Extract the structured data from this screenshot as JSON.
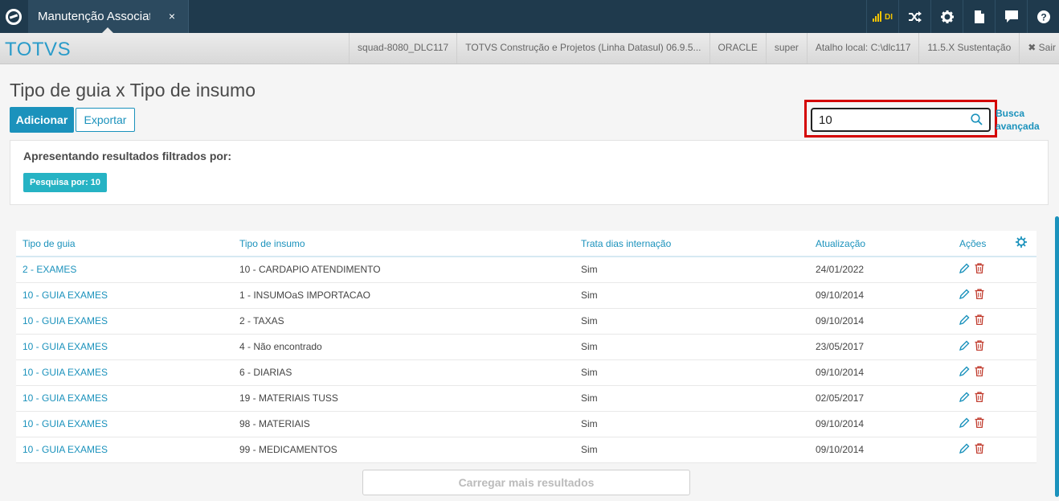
{
  "topbar": {
    "tab_label": "Manutenção Associativa",
    "tab_close": "×",
    "signal_label": "DI"
  },
  "infobar": {
    "brand": "TOTVS",
    "items": [
      "squad-8080_DLC117",
      "TOTVS Construção e Projetos (Linha Datasul) 06.9.5...",
      "ORACLE",
      "super",
      "Atalho local: C:\\dlc117",
      "11.5.X Sustentação"
    ],
    "logout": "✖ Sair"
  },
  "page": {
    "title": "Tipo de guia x Tipo de insumo",
    "add_label": "Adicionar",
    "export_label": "Exportar"
  },
  "search": {
    "value": "10",
    "advanced_line1": "Busca",
    "advanced_line2": "avançada"
  },
  "filter": {
    "title": "Apresentando resultados filtrados por:",
    "chip": "Pesquisa por: 10"
  },
  "table": {
    "headers": [
      "Tipo de guia",
      "Tipo de insumo",
      "Trata dias internação",
      "Atualização",
      "Ações"
    ],
    "rows": [
      [
        "2 - EXAMES",
        "10 - CARDAPIO ATENDIMENTO",
        "Sim",
        "24/01/2022"
      ],
      [
        "10 - GUIA EXAMES",
        "1 - INSUMOaS IMPORTACAO",
        "Sim",
        "09/10/2014"
      ],
      [
        "10 - GUIA EXAMES",
        "2 - TAXAS",
        "Sim",
        "09/10/2014"
      ],
      [
        "10 - GUIA EXAMES",
        "4 - Não encontrado",
        "Sim",
        "23/05/2017"
      ],
      [
        "10 - GUIA EXAMES",
        "6 - DIARIAS",
        "Sim",
        "09/10/2014"
      ],
      [
        "10 - GUIA EXAMES",
        "19 - MATERIAIS TUSS",
        "Sim",
        "02/05/2017"
      ],
      [
        "10 - GUIA EXAMES",
        "98 - MATERIAIS",
        "Sim",
        "09/10/2014"
      ],
      [
        "10 - GUIA EXAMES",
        "99 - MEDICAMENTOS",
        "Sim",
        "09/10/2014"
      ]
    ]
  },
  "load_more_label": "Carregar mais resultados",
  "colors": {
    "accent": "#1b92bc",
    "topbar": "#1f3a4d",
    "highlight": "#d40000",
    "chip": "#26b3c4",
    "delete": "#c0392b"
  }
}
